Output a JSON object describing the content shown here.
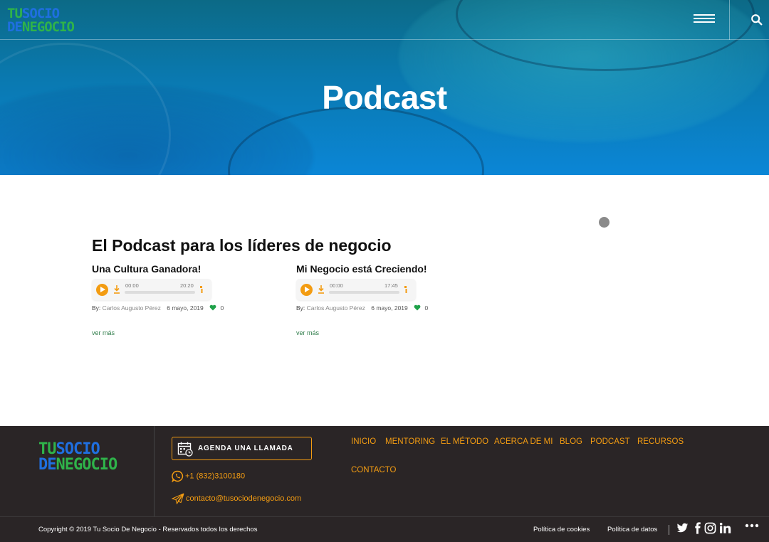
{
  "header": {
    "logo_line1_a": "TU",
    "logo_line1_b": "SOCIO",
    "logo_line2_a": "DE",
    "logo_line2_b": "NEGOCIO"
  },
  "hero": {
    "title": "Podcast"
  },
  "main": {
    "section_title": "El Podcast para los líderes de negocio",
    "episodes": [
      {
        "title": "Una Cultura Ganadora!",
        "time_current": "00:00",
        "time_total": "20:20",
        "by_label": "By:",
        "author": "Carlos Augusto Pérez",
        "date": "6 mayo, 2019",
        "likes": "0",
        "more_label": "ver más"
      },
      {
        "title": "Mi Negocio está Creciendo!",
        "time_current": "00:00",
        "time_total": "17:45",
        "by_label": "By:",
        "author": "Carlos Augusto Pérez",
        "date": "6 mayo, 2019",
        "likes": "0",
        "more_label": "ver más"
      }
    ]
  },
  "footer": {
    "cta_label": "AGENDA UNA LLAMADA",
    "phone": "+1 (832)3100180",
    "email": "contacto@tusociodenegocio.com",
    "nav": [
      "INICIO",
      "MENTORING",
      "EL MÉTODO",
      "ACERCA DE MI",
      "BLOG",
      "PODCAST",
      "RECURSOS",
      "CONTACTO"
    ],
    "copyright": "Copyright © 2019 Tu Socio De Negocio - Reservados todos los derechos",
    "cookies_label": "Política de cookies",
    "data_label": "Política de datos"
  },
  "colors": {
    "accent_orange": "#f39c12",
    "footer_bg": "#2a2526",
    "logo_green": "#2fb34a",
    "logo_blue": "#1f6fe0",
    "like_green": "#1fa24a"
  },
  "icons": [
    "menu-icon",
    "search-icon",
    "play-icon",
    "download-icon",
    "volume-icon",
    "heart-icon",
    "calendar-icon",
    "whatsapp-icon",
    "paper-plane-icon",
    "twitter-icon",
    "facebook-icon",
    "instagram-icon",
    "linkedin-icon",
    "more-dots-icon"
  ]
}
